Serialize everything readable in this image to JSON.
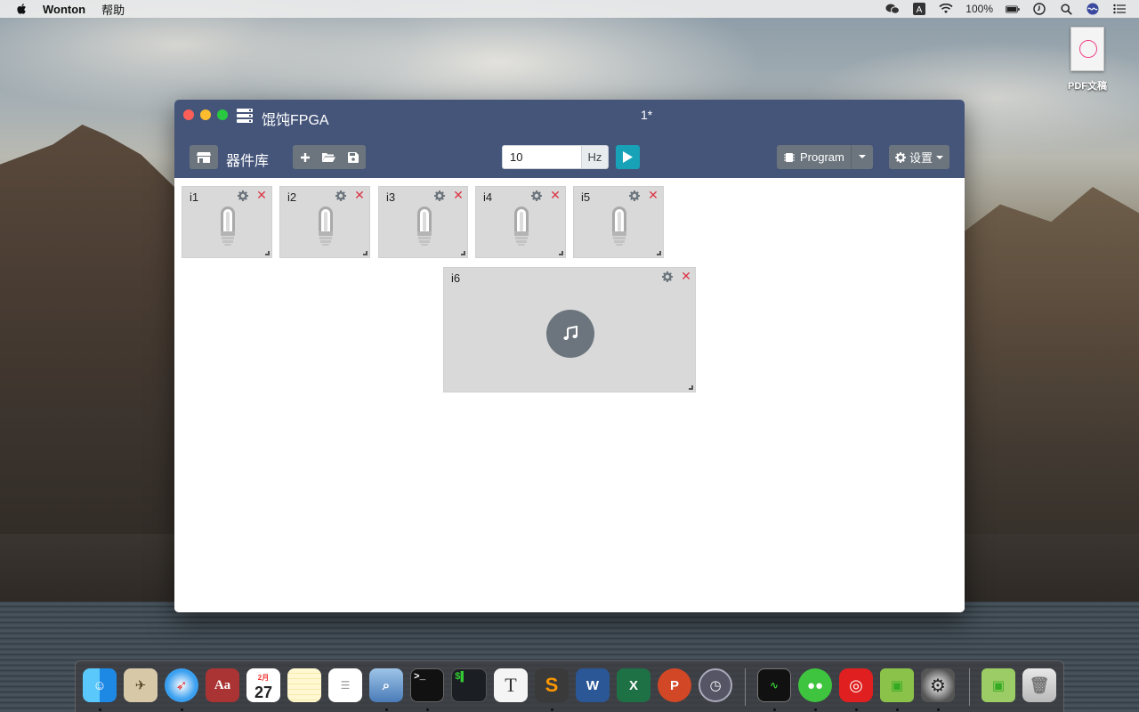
{
  "menubar": {
    "app_name": "Wonton",
    "help_menu": "帮助",
    "battery_text": "100%"
  },
  "desktop": {
    "file_label": "PDF文稿"
  },
  "window": {
    "app_title": "馄饨FPGA",
    "doc_title": "1*",
    "toolbar": {
      "library_label": "器件库",
      "frequency_value": "10",
      "frequency_unit": "Hz",
      "program_label": "Program",
      "settings_label": "设置"
    },
    "components": [
      {
        "id": "i1",
        "type": "bulb"
      },
      {
        "id": "i2",
        "type": "bulb"
      },
      {
        "id": "i3",
        "type": "bulb"
      },
      {
        "id": "i4",
        "type": "bulb"
      },
      {
        "id": "i5",
        "type": "bulb"
      },
      {
        "id": "i6",
        "type": "buzzer"
      }
    ]
  },
  "dock": {
    "apps": [
      "finder-icon",
      "preview-photo-icon",
      "safari-icon",
      "dictionary-icon",
      "calendar-icon",
      "notes-icon",
      "reminders-icon",
      "preview-icon",
      "terminal-icon",
      "console-icon",
      "typora-icon",
      "sublime-text-icon",
      "word-icon",
      "excel-icon",
      "powerpoint-icon",
      "time-machine-icon",
      "activity-monitor-icon",
      "wechat-icon",
      "netease-music-icon",
      "wonton-icon",
      "system-preferences-icon",
      "wonton-downloads-icon",
      "trash-icon"
    ],
    "calendar_day": "27",
    "calendar_month": "2月"
  },
  "colors": {
    "titlebar": "#45557a",
    "secondary_button": "#6c757d",
    "run_button": "#17a2b8",
    "close_red": "#dc3545",
    "card_bg": "#d9d9d9"
  }
}
